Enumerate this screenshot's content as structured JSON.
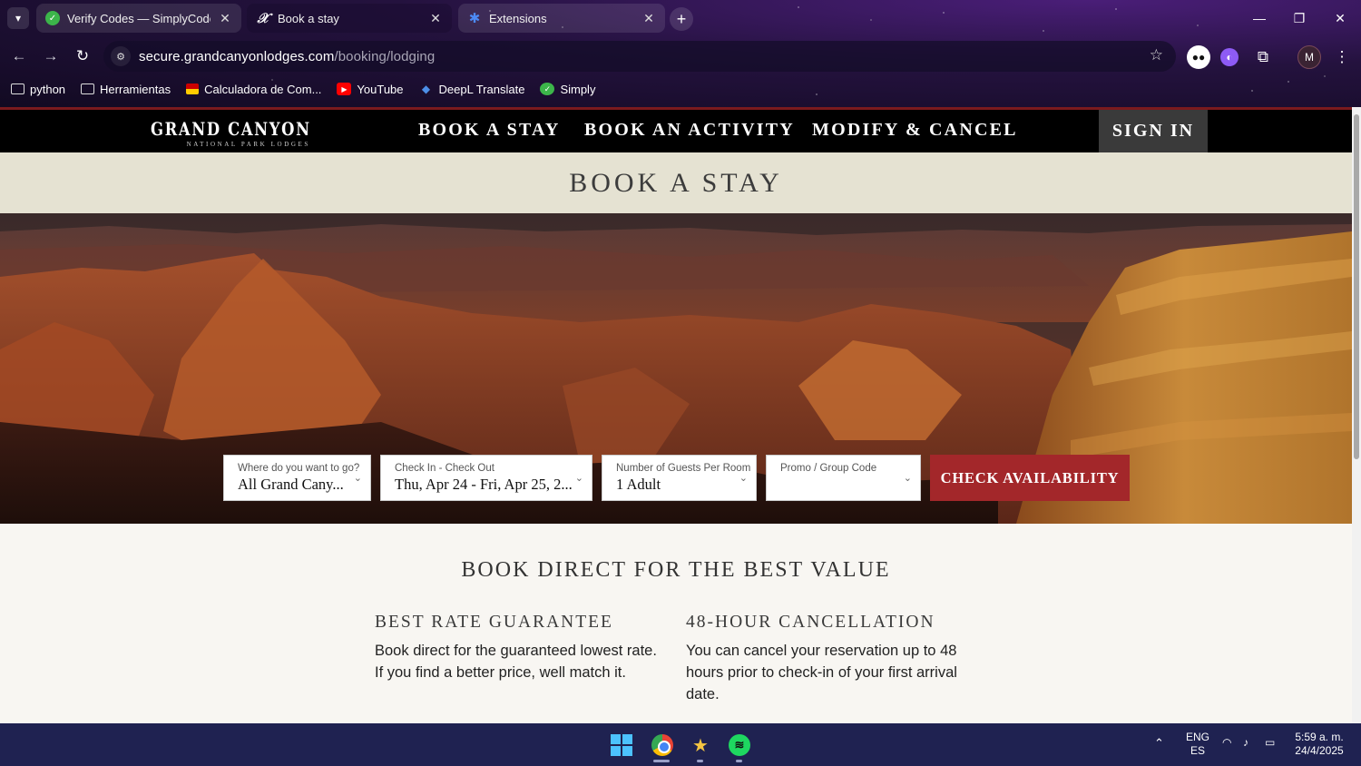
{
  "browser": {
    "tabs": [
      {
        "title": "Verify Codes — SimplyCodes",
        "icon": "simplycodes-icon"
      },
      {
        "title": "Book a stay",
        "icon": "grand-canyon-icon"
      },
      {
        "title": "Extensions",
        "icon": "puzzle-icon"
      }
    ],
    "url_host": "secure.grandcanyonlodges.com",
    "url_path": "/booking/lodging",
    "profile_initial": "M",
    "bookmarks": [
      {
        "label": "python",
        "icon": "folder-icon"
      },
      {
        "label": "Herramientas",
        "icon": "folder-icon"
      },
      {
        "label": "Calculadora de Com...",
        "icon": "calculator-icon"
      },
      {
        "label": "YouTube",
        "icon": "youtube-icon"
      },
      {
        "label": "DeepL Translate",
        "icon": "deepl-icon"
      },
      {
        "label": "Simply",
        "icon": "simply-icon"
      }
    ]
  },
  "site": {
    "logo_main": "GRAND CANYON",
    "logo_sub": "NATIONAL PARK LODGES",
    "nav": [
      "BOOK A STAY",
      "BOOK AN ACTIVITY",
      "MODIFY & CANCEL"
    ],
    "sign_in": "SIGN IN",
    "page_title": "BOOK A STAY",
    "booking": {
      "destination_label": "Where do you want to go?",
      "destination_value": "All Grand Cany...",
      "dates_label": "Check In - Check Out",
      "dates_value": "Thu, Apr 24 - Fri, Apr 25, 2...",
      "guests_label": "Number of Guests Per Room",
      "guests_value": "1 Adult",
      "promo_label": "Promo / Group Code",
      "promo_value": "",
      "check_button": "CHECK AVAILABILITY"
    },
    "value_heading": "BOOK DIRECT FOR THE BEST VALUE",
    "benefits": [
      {
        "title": "BEST RATE GUARANTEE",
        "text": "Book direct for the guaranteed lowest rate. If you find a better price, well match it."
      },
      {
        "title": "48-HOUR CANCELLATION",
        "text": "You can cancel your reservation up to 48 hours prior to check-in of your first arrival date."
      }
    ]
  },
  "taskbar": {
    "lang_top": "ENG",
    "lang_bottom": "ES",
    "time": "5:59 a. m.",
    "date": "24/4/2025"
  }
}
